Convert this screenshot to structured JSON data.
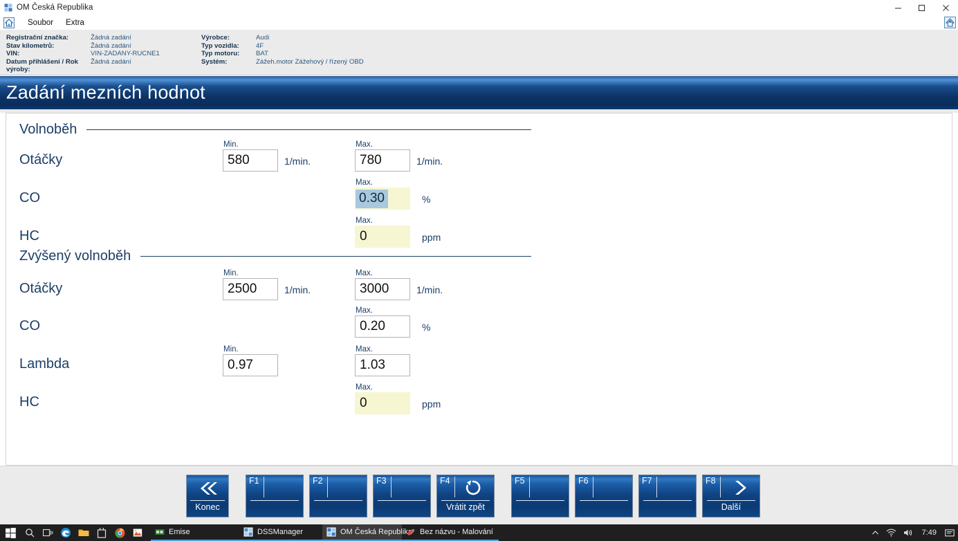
{
  "window": {
    "title": "OM Česká Republika",
    "icon": "app-icon",
    "controls": {
      "minimize": "–",
      "maximize": "☐",
      "close": "✕"
    }
  },
  "menubar": {
    "home_icon": "home-icon",
    "items": [
      "Soubor",
      "Extra"
    ],
    "right_icon": "app-shortcut-icon"
  },
  "vehicle_info": {
    "left": [
      {
        "label": "Registrační značka:",
        "value": "Žádná zadání"
      },
      {
        "label": "Stav kilometrů:",
        "value": "Žádná zadání"
      },
      {
        "label": "VIN:",
        "value": "VIN-ZADANY-RUCNE1"
      },
      {
        "label": "Datum přihlášení / Rok výroby:",
        "value": "Žádná zadání"
      }
    ],
    "right": [
      {
        "label": "Výrobce:",
        "value": "Audi"
      },
      {
        "label": "Typ vozidla:",
        "value": "4F"
      },
      {
        "label": "Typ motoru:",
        "value": "BAT"
      },
      {
        "label": "Systém:",
        "value": "Zážeh.motor Zážehový / řízený OBD"
      }
    ]
  },
  "banner": {
    "title": "Zadání mezních hodnot"
  },
  "form": {
    "sections": [
      {
        "title": "Volnoběh",
        "rows": [
          {
            "label": "Otáčky",
            "min_caption": "Min.",
            "min_value": "580",
            "min_unit": "1/min.",
            "max_caption": "Max.",
            "max_value": "780",
            "max_unit": "1/min."
          },
          {
            "label": "CO",
            "min_caption": "",
            "min_value": "",
            "min_unit": "",
            "max_caption": "Max.",
            "max_value": "0.30",
            "max_unit": "%"
          },
          {
            "label": "HC",
            "min_caption": "",
            "min_value": "",
            "min_unit": "",
            "max_caption": "Max.",
            "max_value": "0",
            "max_unit": "ppm"
          }
        ]
      },
      {
        "title": "Zvýšený volnoběh",
        "rows": [
          {
            "label": "Otáčky",
            "min_caption": "Min.",
            "min_value": "2500",
            "min_unit": "1/min.",
            "max_caption": "Max.",
            "max_value": "3000",
            "max_unit": "1/min."
          },
          {
            "label": "CO",
            "min_caption": "",
            "min_value": "",
            "min_unit": "",
            "max_caption": "Max.",
            "max_value": "0.20",
            "max_unit": "%"
          },
          {
            "label": "Lambda",
            "min_caption": "Min.",
            "min_value": "0.97",
            "min_unit": "",
            "max_caption": "Max.",
            "max_value": "1.03",
            "max_unit": ""
          },
          {
            "label": "HC",
            "min_caption": "",
            "min_value": "",
            "min_unit": "",
            "max_caption": "Max.",
            "max_value": "0",
            "max_unit": "ppm"
          }
        ]
      }
    ]
  },
  "function_bar": {
    "buttons": [
      {
        "code": "",
        "caption": "Konec",
        "icon": "chevron-double-left-icon"
      },
      {
        "code": "F1",
        "caption": "",
        "icon": ""
      },
      {
        "code": "F2",
        "caption": "",
        "icon": ""
      },
      {
        "code": "F3",
        "caption": "",
        "icon": ""
      },
      {
        "code": "F4",
        "caption": "Vrátit zpět",
        "icon": "undo-circular-arrow-icon"
      },
      {
        "code": "F5",
        "caption": "",
        "icon": ""
      },
      {
        "code": "F6",
        "caption": "",
        "icon": ""
      },
      {
        "code": "F7",
        "caption": "",
        "icon": ""
      },
      {
        "code": "F8",
        "caption": "Další",
        "icon": "chevron-right-icon"
      }
    ]
  },
  "taskbar": {
    "start_icon": "windows-start-icon",
    "quick_icons": [
      "search-icon",
      "task-view-icon",
      "edge-icon",
      "file-explorer-icon",
      "store-icon",
      "chrome-icon",
      "photos-icon"
    ],
    "apps": [
      {
        "label": "Emise",
        "icon": "emise-icon",
        "active": false
      },
      {
        "label": "DSSManager",
        "icon": "dssmanager-icon",
        "active": false
      },
      {
        "label": "OM Česká Republika",
        "icon": "om-icon",
        "active": true
      },
      {
        "label": "Bez názvu - Malování",
        "icon": "paint-icon",
        "active": false
      }
    ],
    "tray": {
      "overflow_icon": "chevron-up-icon",
      "network_icon": "wifi-icon",
      "volume_icon": "speaker-icon",
      "clock": "7:49",
      "notifications_icon": "notification-icon"
    }
  },
  "colors": {
    "banner_blue": "#0c3366",
    "accent_navy": "#1b3f66",
    "field_yellow": "#f6f6d2",
    "selection_blue": "#a8c8dd",
    "taskbar_dark": "#1f1f1f"
  }
}
